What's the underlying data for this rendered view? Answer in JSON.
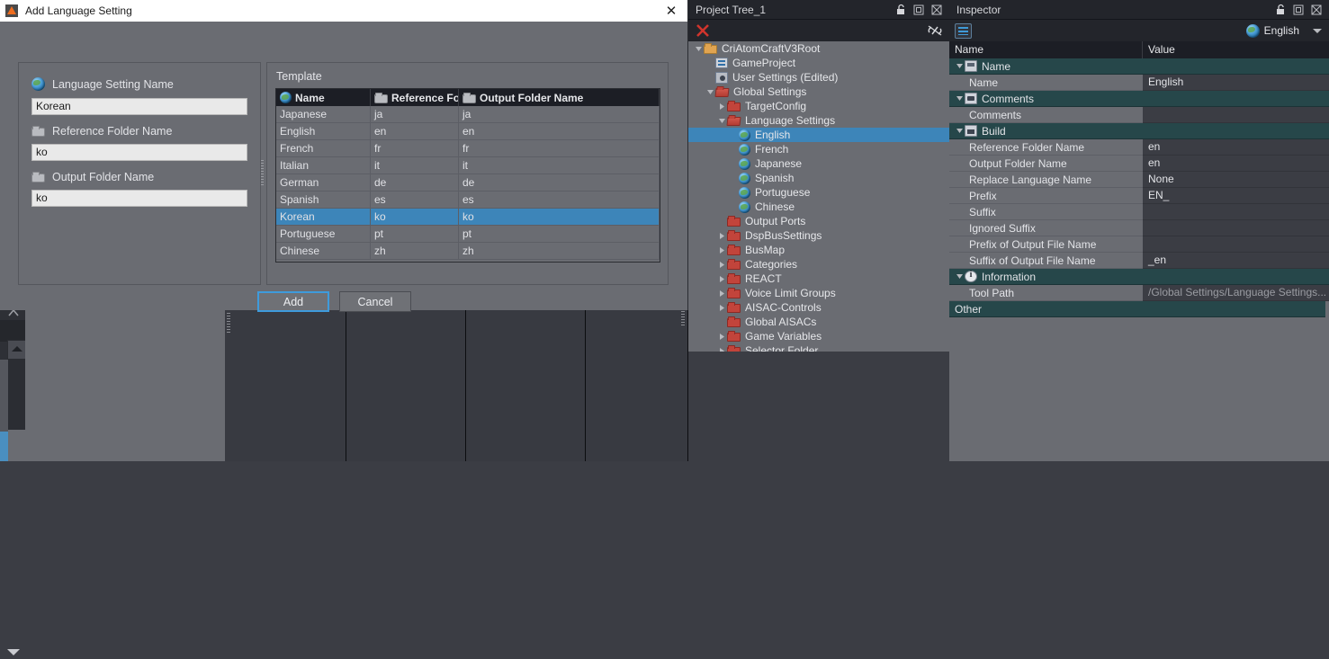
{
  "dialog": {
    "title": "Add Language Setting",
    "close_label": "✕",
    "left": {
      "fields": [
        {
          "label": "Language Setting Name",
          "icon": "globe-icon",
          "value": "Korean"
        },
        {
          "label": "Reference Folder Name",
          "icon": "folder-icon",
          "value": "ko"
        },
        {
          "label": "Output Folder Name",
          "icon": "folder-icon",
          "value": "ko"
        }
      ]
    },
    "template": {
      "label": "Template",
      "columns": [
        "Name",
        "Reference Fold",
        "Output Folder Name"
      ],
      "rows": [
        {
          "name": "Japanese",
          "ref": "ja",
          "out": "ja",
          "selected": false
        },
        {
          "name": "English",
          "ref": "en",
          "out": "en",
          "selected": false
        },
        {
          "name": "French",
          "ref": "fr",
          "out": "fr",
          "selected": false
        },
        {
          "name": "Italian",
          "ref": "it",
          "out": "it",
          "selected": false
        },
        {
          "name": "German",
          "ref": "de",
          "out": "de",
          "selected": false
        },
        {
          "name": "Spanish",
          "ref": "es",
          "out": "es",
          "selected": false
        },
        {
          "name": "Korean",
          "ref": "ko",
          "out": "ko",
          "selected": true
        },
        {
          "name": "Portuguese",
          "ref": "pt",
          "out": "pt",
          "selected": false
        },
        {
          "name": "Chinese",
          "ref": "zh",
          "out": "zh",
          "selected": false
        }
      ]
    },
    "buttons": {
      "add": "Add",
      "cancel": "Cancel"
    }
  },
  "project_tree": {
    "title": "Project Tree_1",
    "nodes": [
      {
        "label": "CriAtomCraftV3Root",
        "depth": 0,
        "icon": "folder-orange-icon",
        "twist": "open",
        "selected": false
      },
      {
        "label": "GameProject",
        "depth": 1,
        "icon": "project-icon",
        "twist": "none",
        "selected": false
      },
      {
        "label": "User Settings (Edited)",
        "depth": 1,
        "icon": "settings-icon",
        "twist": "none",
        "selected": false
      },
      {
        "label": "Global Settings",
        "depth": 1,
        "icon": "folder-red-open-icon",
        "twist": "open",
        "selected": false
      },
      {
        "label": "TargetConfig",
        "depth": 2,
        "icon": "folder-red-icon",
        "twist": "closed",
        "selected": false
      },
      {
        "label": "Language Settings",
        "depth": 2,
        "icon": "folder-red-open-icon",
        "twist": "open",
        "selected": false
      },
      {
        "label": "English",
        "depth": 3,
        "icon": "globe-icon",
        "twist": "none",
        "selected": true
      },
      {
        "label": "French",
        "depth": 3,
        "icon": "globe-icon",
        "twist": "none",
        "selected": false
      },
      {
        "label": "Japanese",
        "depth": 3,
        "icon": "globe-icon",
        "twist": "none",
        "selected": false
      },
      {
        "label": "Spanish",
        "depth": 3,
        "icon": "globe-icon",
        "twist": "none",
        "selected": false
      },
      {
        "label": "Portuguese",
        "depth": 3,
        "icon": "globe-icon",
        "twist": "none",
        "selected": false
      },
      {
        "label": "Chinese",
        "depth": 3,
        "icon": "globe-icon",
        "twist": "none",
        "selected": false
      },
      {
        "label": "Output Ports",
        "depth": 2,
        "icon": "folder-red-icon",
        "twist": "none",
        "selected": false
      },
      {
        "label": "DspBusSettings",
        "depth": 2,
        "icon": "folder-red-icon",
        "twist": "closed",
        "selected": false
      },
      {
        "label": "BusMap",
        "depth": 2,
        "icon": "folder-red-icon",
        "twist": "closed",
        "selected": false
      },
      {
        "label": "Categories",
        "depth": 2,
        "icon": "folder-red-icon",
        "twist": "closed",
        "selected": false
      },
      {
        "label": "REACT",
        "depth": 2,
        "icon": "folder-red-icon",
        "twist": "closed",
        "selected": false
      },
      {
        "label": "Voice Limit Groups",
        "depth": 2,
        "icon": "folder-red-icon",
        "twist": "closed",
        "selected": false
      },
      {
        "label": "AISAC-Controls",
        "depth": 2,
        "icon": "folder-red-icon",
        "twist": "closed",
        "selected": false
      },
      {
        "label": "Global AISACs",
        "depth": 2,
        "icon": "folder-red-icon",
        "twist": "none",
        "selected": false
      },
      {
        "label": "Game Variables",
        "depth": 2,
        "icon": "folder-red-icon",
        "twist": "closed",
        "selected": false
      },
      {
        "label": "Selector Folder",
        "depth": 2,
        "icon": "folder-red-icon",
        "twist": "closed",
        "selected": false
      }
    ]
  },
  "inspector": {
    "title": "Inspector",
    "language": "English",
    "columns": {
      "name": "Name",
      "value": "Value"
    },
    "rows": [
      {
        "kind": "group",
        "icon": "name-icon",
        "name": "Name",
        "value": ""
      },
      {
        "kind": "item",
        "name": "Name",
        "value": "English"
      },
      {
        "kind": "group",
        "icon": "comment-icon",
        "name": "Comments",
        "value": ""
      },
      {
        "kind": "item",
        "name": "Comments",
        "value": ""
      },
      {
        "kind": "group",
        "icon": "build-icon",
        "name": "Build",
        "value": ""
      },
      {
        "kind": "item",
        "name": "Reference Folder Name",
        "value": "en"
      },
      {
        "kind": "item",
        "name": "Output Folder Name",
        "value": "en"
      },
      {
        "kind": "item",
        "name": "Replace Language Name",
        "value": "None"
      },
      {
        "kind": "item",
        "name": "Prefix",
        "value": "EN_"
      },
      {
        "kind": "item",
        "name": "Suffix",
        "value": ""
      },
      {
        "kind": "item",
        "name": "Ignored Suffix",
        "value": ""
      },
      {
        "kind": "item",
        "name": "Prefix of Output File Name",
        "value": ""
      },
      {
        "kind": "item",
        "name": "Suffix of Output File Name",
        "value": "_en"
      },
      {
        "kind": "group",
        "icon": "info-icon",
        "name": "Information",
        "value": ""
      },
      {
        "kind": "item",
        "name": "Tool Path",
        "value": "/Global Settings/Language Settings...",
        "dim": true
      },
      {
        "kind": "groupfull",
        "name": "Other",
        "value": ""
      }
    ]
  },
  "colors": {
    "selection_blue": "#3d85b9",
    "group_teal": "#26474a",
    "panel_gray": "#6a6c72",
    "dark_gray": "#3b3d44",
    "header_dark": "#1c1e25"
  }
}
